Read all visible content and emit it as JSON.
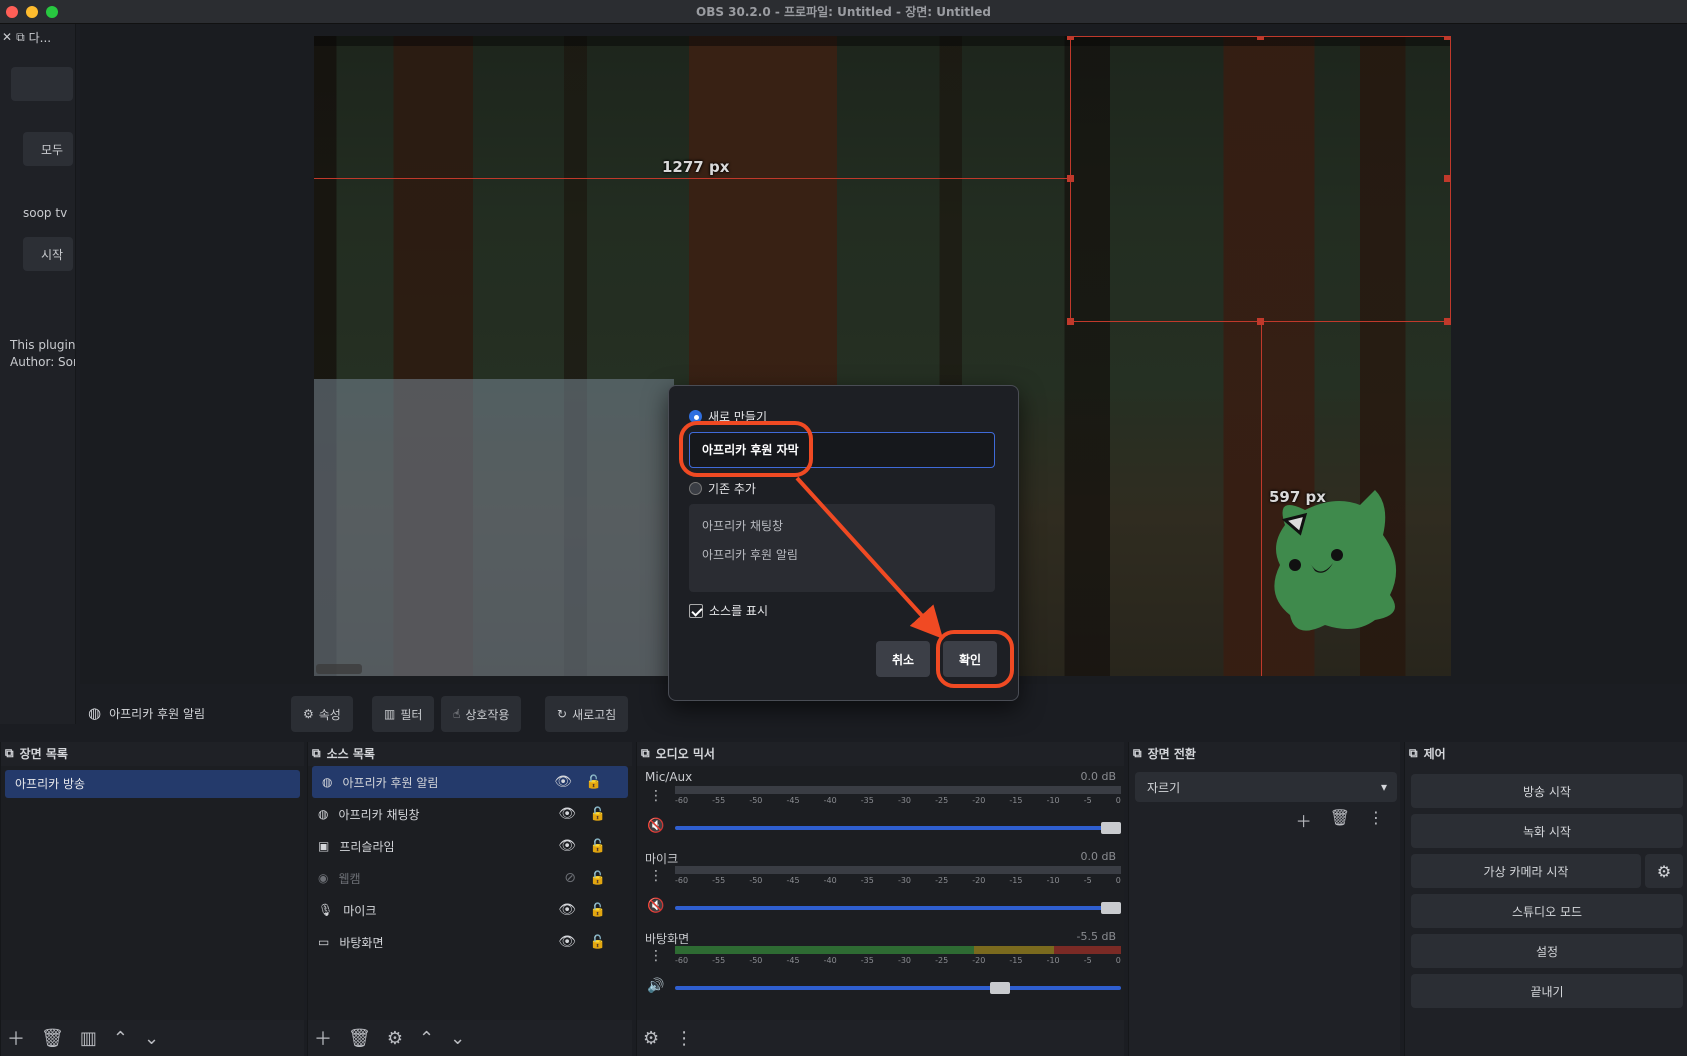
{
  "window": {
    "title": "OBS 30.2.0 - 프로파일: Untitled - 장면: Untitled"
  },
  "left_dock": {
    "title": "다...",
    "btn1": "모두 ",
    "label": "soop tv",
    "btn2": "시작",
    "line1": "This plugin",
    "line2": "Author: Sor"
  },
  "preview": {
    "label_width": "1277 px",
    "label_height": "597 px"
  },
  "dialog": {
    "radio_new": "새로 만들기",
    "name_value": "아프리카 후원 자막",
    "radio_existing": "기존 추가",
    "existing_items": [
      "아프리카 채팅창",
      "아프리카 후원 알림"
    ],
    "checkbox_label": "소스를 표시",
    "cancel": "취소",
    "ok": "확인"
  },
  "source_toolbar": {
    "current_source": "아프리카 후원 알림",
    "properties": "속성",
    "filters": "필터",
    "interact": "상호작용",
    "refresh": "새로고침"
  },
  "scenes": {
    "title": "장면 목록",
    "items": [
      "아프리카 방송"
    ]
  },
  "sources": {
    "title": "소스 목록",
    "items": [
      "아프리카 후원 알림",
      "아프리카 채팅창",
      "프리슬라임",
      "웹캠",
      "마이크",
      "바탕화면"
    ]
  },
  "mixer": {
    "title": "오디오 믹서",
    "scale": [
      "-60",
      "-55",
      "-50",
      "-45",
      "-40",
      "-35",
      "-30",
      "-25",
      "-20",
      "-15",
      "-10",
      "-5",
      "0"
    ],
    "channels": [
      {
        "name": "Mic/Aux",
        "db": "0.0 dB",
        "volume": 1.0,
        "muted": true
      },
      {
        "name": "마이크",
        "db": "0.0 dB",
        "volume": 1.0,
        "muted": true
      },
      {
        "name": "바탕화면",
        "db": "-5.5 dB",
        "volume": 0.75,
        "muted": false
      }
    ]
  },
  "transitions": {
    "title": "장면 전환",
    "selected": "자르기"
  },
  "controls": {
    "title": "제어",
    "start_stream": "방송 시작",
    "start_record": "녹화 시작",
    "virtual_cam": "가상 카메라 시작",
    "studio_mode": "스튜디오 모드",
    "settings": "설정",
    "exit": "끝내기"
  },
  "colors": {
    "accent": "#2f6fe0",
    "highlight": "#f04a23",
    "selection": "#c0392b",
    "selected_row": "#243a6b"
  }
}
